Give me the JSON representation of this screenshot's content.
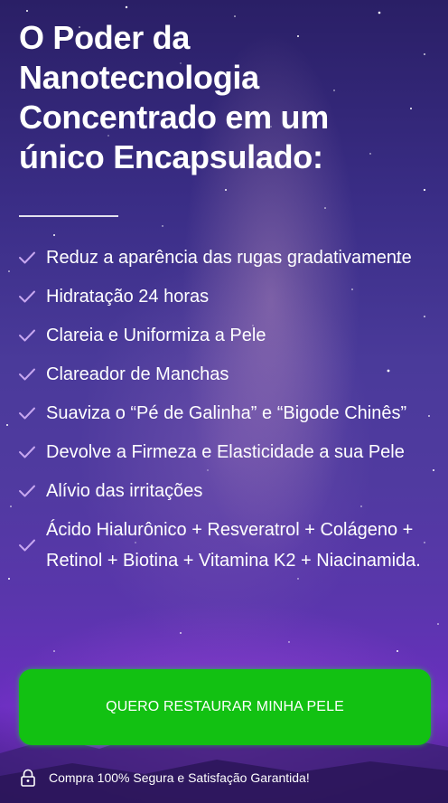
{
  "headline": "O Poder da Nanotecnologia Concentrado em um único Encapsulado:",
  "benefits": [
    {
      "text": "Reduz a aparência das rugas gradativamente",
      "icon": "check-icon"
    },
    {
      "text": "Hidratação 24 horas",
      "icon": "check-icon"
    },
    {
      "text": "Clareia e Uniformiza a Pele",
      "icon": "check-icon"
    },
    {
      "text": "Clareador de Manchas",
      "icon": "check-icon"
    },
    {
      "text": "Suaviza o “Pé de Galinha” e “Bigode Chinês”",
      "icon": "check-icon"
    },
    {
      "text": "Devolve a Firmeza e Elasticidade a sua Pele",
      "icon": "check-icon"
    },
    {
      "text": "Alívio das irritações",
      "icon": "check-icon"
    },
    {
      "text": "Ácido Hialurônico + Resveratrol + Colágeno + Retinol + Biotina + Vitamina K2 + Niacinamida.",
      "icon": "check-icon"
    }
  ],
  "cta": {
    "label": "QUERO RESTAURAR MINHA PELE",
    "color": "#12c112"
  },
  "secure_note": {
    "text": "Compra 100% Segura e Satisfação Garantida!",
    "icon": "lock-icon"
  },
  "colors": {
    "check": "#c7a7f0",
    "text": "#ffffff"
  }
}
